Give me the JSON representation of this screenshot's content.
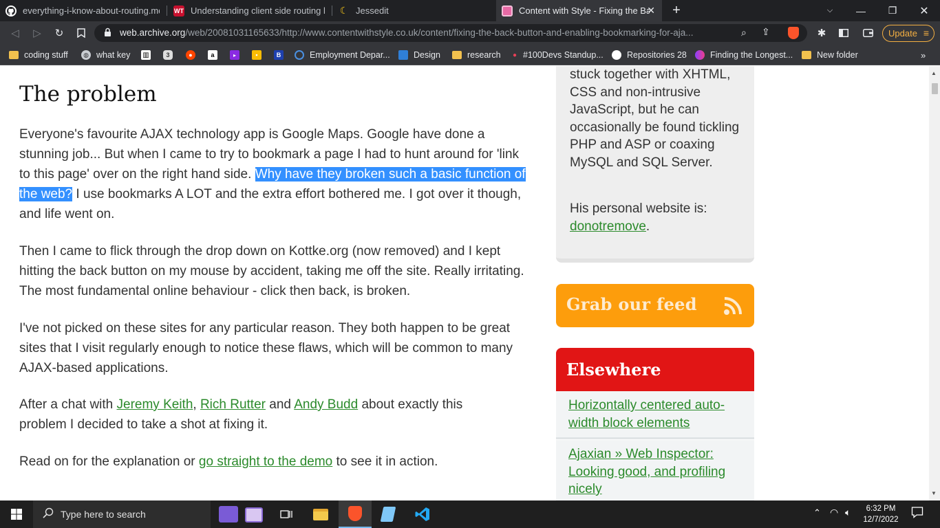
{
  "tabs": [
    {
      "title": "everything-i-know-about-routing.md",
      "icon": "github-icon"
    },
    {
      "title": "Understanding client side routing by i",
      "icon": "wt-logo-icon"
    },
    {
      "title": "Jessedit",
      "icon": "moon-icon"
    },
    {
      "title": "Content with Style - Fixing the Ba",
      "icon": "cws-icon"
    }
  ],
  "address": {
    "host": "web.archive.org",
    "path": "/web/20081031165633/http://www.contentwithstyle.co.uk/content/fixing-the-back-button-and-enabling-bookmarking-for-aja..."
  },
  "update_label": "Update",
  "bookmarks": [
    {
      "label": "coding stuff",
      "icon": "folder-icon"
    },
    {
      "label": "what key",
      "icon": "globe-icon"
    },
    {
      "label": "",
      "icon": "piano-icon"
    },
    {
      "label": "",
      "icon": "circle-icon"
    },
    {
      "label": "",
      "icon": "reddit-icon"
    },
    {
      "label": "",
      "icon": "amazon-icon"
    },
    {
      "label": "",
      "icon": "bookmark-app-icon"
    },
    {
      "label": "",
      "icon": "keep-icon"
    },
    {
      "label": "",
      "icon": "b-icon"
    },
    {
      "label": "Employment Depar...",
      "icon": "edd-icon"
    },
    {
      "label": "Design",
      "icon": "design-icon"
    },
    {
      "label": "research",
      "icon": "folder-icon"
    },
    {
      "label": "#100Devs Standup...",
      "icon": "dot-icon"
    },
    {
      "label": "Repositories 28",
      "icon": "github-icon"
    },
    {
      "label": "Finding the Longest...",
      "icon": "twitter-dev-icon"
    },
    {
      "label": "New folder",
      "icon": "folder-icon"
    }
  ],
  "article": {
    "heading": "The problem",
    "p1_a": "Everyone's favourite AJAX technology app is Google Maps. Google have done a stunning job... But when I came to try to bookmark a page I had to hunt around for 'link to this page' over on the right hand side. ",
    "p1_hl": "Why have they broken such a basic function of the web?",
    "p1_b": " I use bookmarks A LOT and the extra effort bothered me. I got over it though, and life went on.",
    "p2": "Then I came to flick through the drop down on Kottke.org (now removed) and I kept hitting the back button on my mouse by accident, taking me off the site. Really irritating. The most fundamental online behaviour - click then back, is broken.",
    "p3": "I've not picked on these sites for any particular reason. They both happen to be great sites that I visit regularly enough to notice these flaws, which will be common to many AJAX-based applications.",
    "p4_a": "After a chat with ",
    "p4_link1": "Jeremy Keith",
    "p4_sep1": ", ",
    "p4_link2": "Rich Rutter",
    "p4_sep2": " and ",
    "p4_link3": "Andy Budd",
    "p4_b": " about exactly this problem I decided to take a shot at fixing it.",
    "p5_a": "Read on for the explanation or ",
    "p5_link": "go straight to the demo",
    "p5_b": " to see it in action."
  },
  "sidebar": {
    "bio": "stuck together with XHTML, CSS and non-intrusive JavaScript, but he can occasionally be found tickling PHP and ASP or coaxing MySQL and SQL Server.",
    "site_prefix": "His personal website is:",
    "site_link": "donotremove",
    "site_suffix": ".",
    "feed_label": "Grab our feed",
    "elsewhere_label": "Elsewhere",
    "elsewhere_items": [
      "Horizontally centered auto-width block elements",
      "Ajaxian » Web Inspector: Looking good, and profiling nicely"
    ]
  },
  "taskbar": {
    "search_placeholder": "Type here to search",
    "time": "6:32 PM",
    "date": "12/7/2022"
  },
  "colors": {
    "accent_link": "#2b8a2b",
    "selection": "#3390ff",
    "feed_orange": "#fd9d0c",
    "elsewhere_red": "#e11515"
  }
}
